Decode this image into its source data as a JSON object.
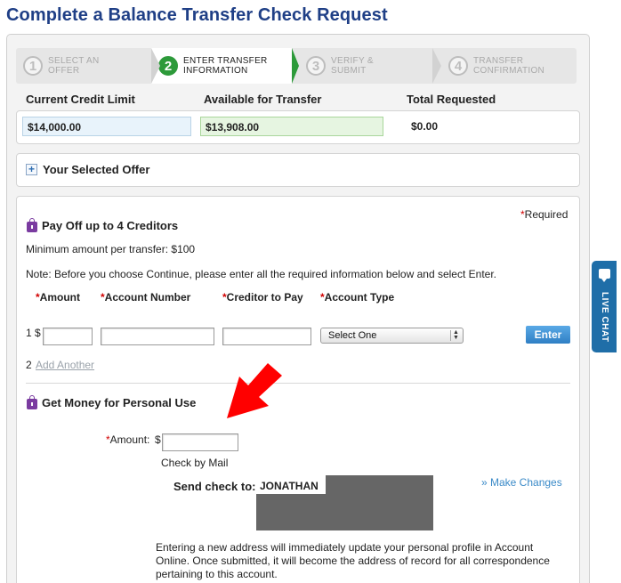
{
  "page_title": "Complete a Balance Transfer Check Request",
  "steps": [
    {
      "num": "1",
      "label": "SELECT AN OFFER"
    },
    {
      "num": "2",
      "label": "ENTER TRANSFER INFORMATION"
    },
    {
      "num": "3",
      "label": "VERIFY & SUBMIT"
    },
    {
      "num": "4",
      "label": "TRANSFER CONFIRMATION"
    }
  ],
  "limits": {
    "current_credit_limit_label": "Current Credit Limit",
    "current_credit_limit_value": "$14,000.00",
    "available_label": "Available for Transfer",
    "available_value": "$13,908.00",
    "total_requested_label": "Total Requested",
    "total_requested_value": "$0.00"
  },
  "offer": {
    "label": "Your Selected Offer"
  },
  "required_note": {
    "star": "*",
    "text": "Required"
  },
  "creditors": {
    "title": "Pay Off up to 4 Creditors",
    "min_amount": "Minimum amount per transfer: $100",
    "note": "Note: Before you choose Continue, please enter all the required information below and select Enter.",
    "columns": [
      {
        "star": "*",
        "label": "Amount"
      },
      {
        "star": "*",
        "label": "Account Number"
      },
      {
        "star": "*",
        "label": "Creditor to Pay"
      },
      {
        "star": "*",
        "label": "Account Type"
      }
    ],
    "row_index": "1",
    "currency": "$",
    "account_type_selected": "Select One",
    "enter_button": "Enter",
    "add_index": "2",
    "add_another": "Add Another"
  },
  "personal": {
    "title": "Get Money for Personal Use",
    "amount_star": "*",
    "amount_label": "Amount:",
    "currency": "$",
    "method": "Check by Mail",
    "send_to_label": "Send check to:",
    "send_to_name": "JONATHAN",
    "make_changes": "» Make Changes",
    "address_note": "Entering a new address will immediately update your personal profile in Account Online. Once submitted, it will become the address of record for all correspondence pertaining to this account."
  },
  "live_chat": {
    "label": "LIVE CHAT"
  },
  "colors": {
    "title_blue": "#1f3f86",
    "active_step_green": "#2d9a3a",
    "required_red": "#d10000",
    "link_blue": "#3a8ac8",
    "enter_button_blue": "#2f7fc4",
    "annotation_arrow": "#ff0000",
    "live_chat_blue": "#1f6ea8"
  },
  "icons": {
    "offer_toggle": "plus-icon",
    "section_lock": "lock-icon",
    "select_arrows": "up-down-arrows-icon",
    "chat": "chat-bubble-icon",
    "annotation": "red-arrow-annotation"
  }
}
